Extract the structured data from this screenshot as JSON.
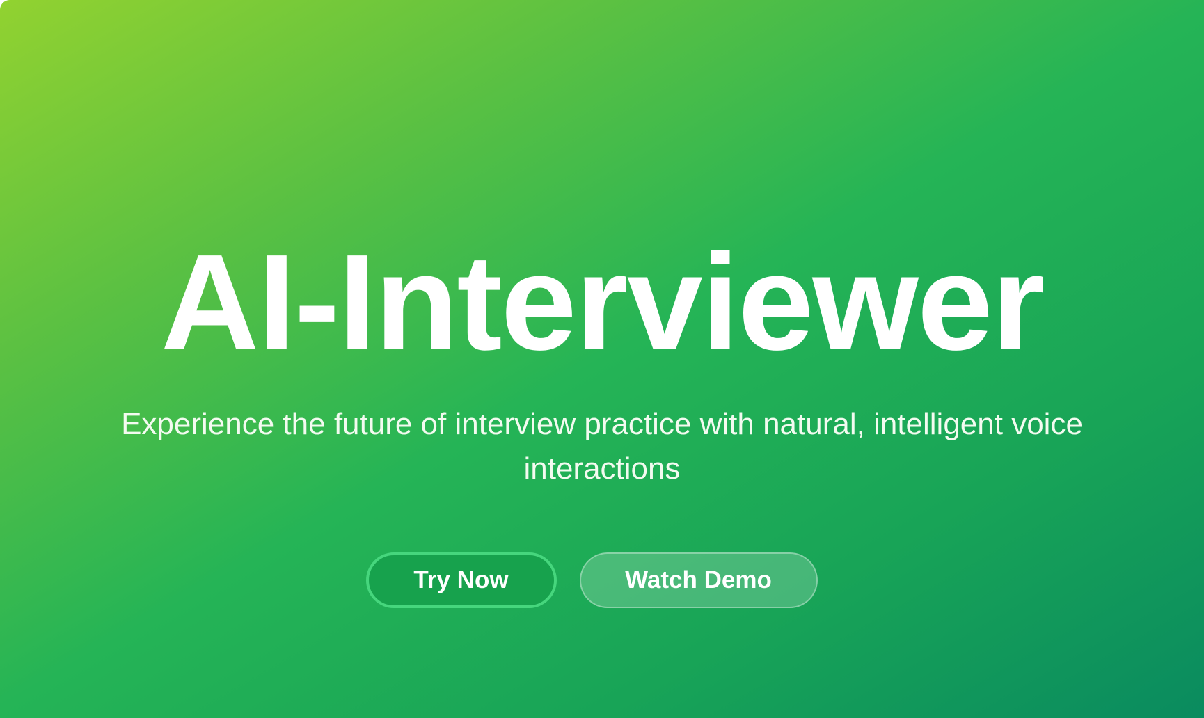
{
  "hero": {
    "title": "AI-Interviewer",
    "subtitle": "Experience the future of interview practice with natural, intelligent voice interactions",
    "buttons": {
      "try_now": "Try Now",
      "watch_demo": "Watch Demo"
    }
  },
  "colors": {
    "gradient_start": "#92d230",
    "gradient_mid": "#25b456",
    "gradient_end": "#0a8b5f",
    "primary_button": "#17a24d",
    "primary_button_border": "#46d67d"
  }
}
